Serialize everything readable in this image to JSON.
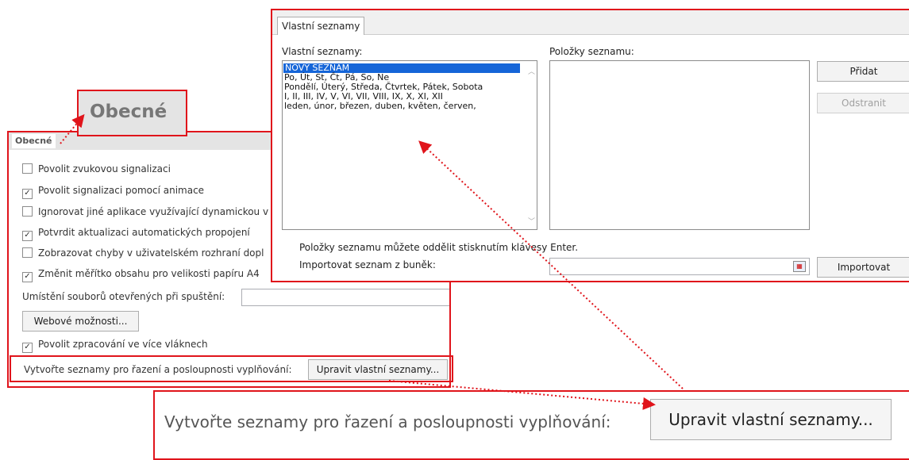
{
  "general": {
    "tab_label": "Obecné",
    "options": [
      {
        "label": "Povolit zvukovou signalizaci",
        "checked": false
      },
      {
        "label": "Povolit signalizaci pomocí animace",
        "checked": true
      },
      {
        "label": "Ignorovat jiné aplikace využívající dynamickou v",
        "checked": false
      },
      {
        "label": "Potvrdit aktualizaci automatických propojení",
        "checked": true
      },
      {
        "label": "Zobrazovat chyby v uživatelském rozhraní dopl",
        "checked": false
      },
      {
        "label": "Změnit měřítko obsahu pro velikosti papíru A4",
        "checked": true
      }
    ],
    "startup_location_label": "Umístění souborů otevřených při spuštění:",
    "startup_location_value": "",
    "web_options_button": "Webové možnosti...",
    "multithread_label": "Povolit zpracování ve více vláknech",
    "multithread_checked": true,
    "custom_lists_prompt": "Vytvořte seznamy pro řazení a posloupnosti vyplňování:",
    "edit_lists_button": "Upravit vlastní seznamy..."
  },
  "zoom_tab_label": "Obecné",
  "dialog": {
    "tab_label": "Vlastní seznamy",
    "lists_label": "Vlastní seznamy:",
    "entries_label": "Položky seznamu:",
    "lists": [
      {
        "text": "NOVÝ SEZNAM",
        "selected": true
      },
      {
        "text": "Po, Út, St, Čt, Pá, So, Ne",
        "selected": false
      },
      {
        "text": "Pondělí, Úterý, Středa, Čtvrtek, Pátek, Sobota",
        "selected": false
      },
      {
        "text": "I, II, III, IV, V, VI, VII, VIII, IX, X, XI, XII",
        "selected": false
      },
      {
        "text": "leden, únor, březen, duben, květen, červen,",
        "selected": false
      }
    ],
    "add_button": "Přidat",
    "remove_button": "Odstranit",
    "hint": "Položky seznamu můžete oddělit stisknutím klávesy Enter.",
    "import_label": "Importovat seznam z buněk:",
    "import_value": "",
    "import_button": "Importovat"
  },
  "banner": {
    "prompt": "Vytvořte seznamy pro řazení a posloupnosti vyplňování:",
    "button": "Upravit vlastní seznamy..."
  },
  "colors": {
    "highlight": "#e0141b",
    "selection": "#1565d8"
  }
}
